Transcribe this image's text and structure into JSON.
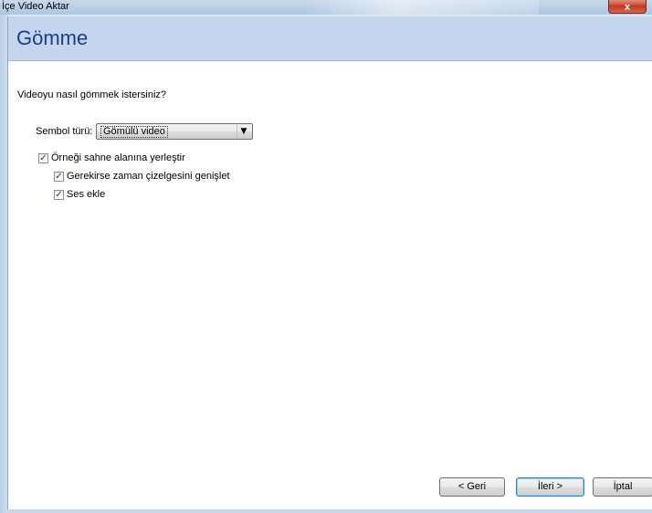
{
  "window": {
    "title": "İçe Video Aktar",
    "close_glyph": "x"
  },
  "header": {
    "title": "Gömme"
  },
  "main": {
    "question": "Videoyu nasıl gömmek istersiniz?",
    "symbol_type": {
      "label": "Sembol türü:",
      "selected": "Gömülü video"
    },
    "checkboxes": [
      {
        "label": "Örneği sahne alanına yerleştir",
        "checked": true
      },
      {
        "label": "Gerekirse zaman çizelgesini genişlet",
        "checked": true
      },
      {
        "label": "Ses ekle",
        "checked": true
      }
    ]
  },
  "footer": {
    "back_label": "< Geri",
    "next_label": "İleri >",
    "cancel_label": "İptal"
  },
  "check_glyph": "✓"
}
